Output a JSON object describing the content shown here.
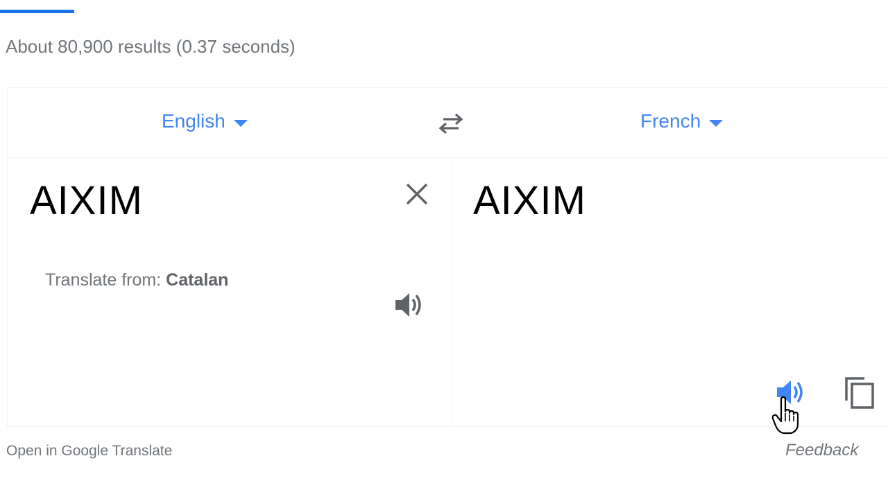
{
  "result_stats": "About 80,900 results (0.37 seconds)",
  "translator": {
    "source_language": "English",
    "target_language": "French",
    "source_text": "AIXIM",
    "translated_text": "AIXIM",
    "translate_from_prefix": "Translate from:",
    "translate_from_language": "Catalan",
    "icons": {
      "swap": "swap-arrows-icon",
      "clear": "close-icon",
      "listen_source": "speaker-icon",
      "listen_target": "speaker-icon",
      "copy": "copy-icon",
      "cursor": "hand-pointer-icon"
    }
  },
  "footer": {
    "open_link": "Open in Google Translate",
    "feedback": "Feedback"
  },
  "colors": {
    "accent": "#4285f4",
    "tab_indicator": "#1a73e8",
    "icon_gray": "#5f6368",
    "muted_text": "#70757a"
  }
}
